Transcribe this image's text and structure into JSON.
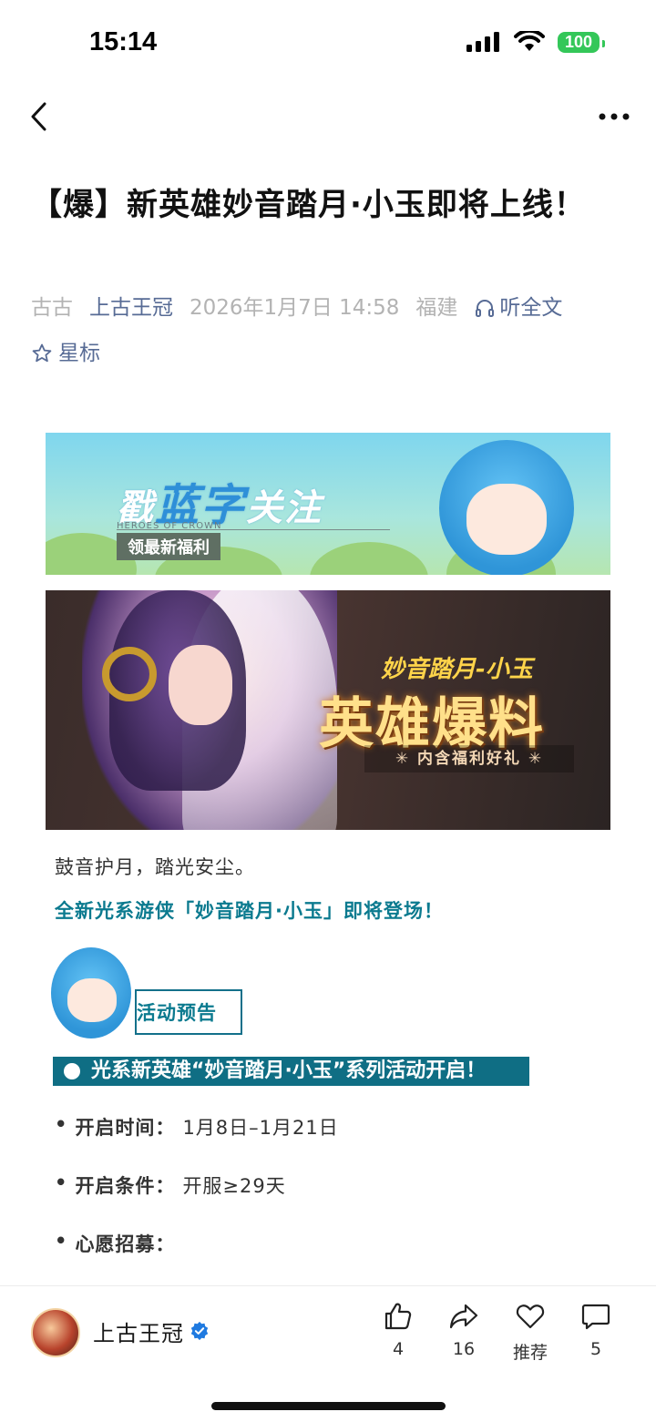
{
  "status": {
    "time": "15:14",
    "battery": "100"
  },
  "nav": {
    "back_icon": "chevron-left-icon",
    "more_icon": "ellipsis-icon"
  },
  "article": {
    "title": "【爆】新英雄妙音踏月·小玉即将上线！",
    "author": "古古",
    "account": "上古王冠",
    "date": "2026年1月7日 14:58",
    "location": "福建",
    "listen_label": "听全文",
    "star_label": "星标"
  },
  "banner1": {
    "text_prefix": "戳",
    "text_blue": "蓝字",
    "text_suffix": "关注",
    "subtitle": "HEROES OF CROWN",
    "tag": "领最新福利"
  },
  "banner2": {
    "small_title": "妙音踏月-小玉",
    "big_title": "英雄爆料",
    "ribbon": "✳  内含福利好礼  ✳"
  },
  "body": {
    "para1": "鼓音护月，踏光安尘。",
    "para2": "全新光系游侠「妙音踏月·小玉」即将登场！",
    "section_label": "活动预告",
    "highlight": "光系新英雄“妙音踏月·小玉”系列活动开启！",
    "items": [
      {
        "key": "开启时间：",
        "value": "1月8日–1月21日"
      },
      {
        "key": "开启条件：",
        "value": "开服≥29天"
      },
      {
        "key": "心愿招募：",
        "value": ""
      }
    ]
  },
  "bottom": {
    "account_name": "上古王冠",
    "like_count": "4",
    "share_count": "16",
    "recommend_label": "推荐",
    "comment_count": "5"
  },
  "colors": {
    "accent": "#576b95",
    "teal": "#0f6e84",
    "battery": "#34c759"
  }
}
